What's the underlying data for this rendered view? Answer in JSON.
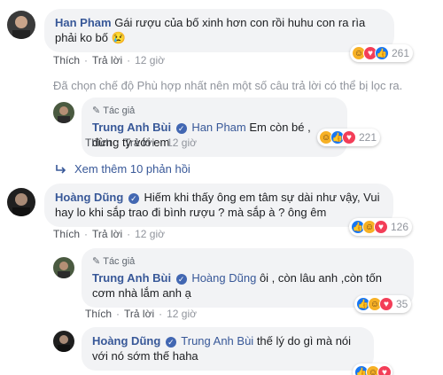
{
  "author_badge": "Tác giả",
  "actions": {
    "like": "Thích",
    "reply": "Trả lời",
    "separator": "·"
  },
  "verified_mark": "✓",
  "comments": [
    {
      "name": "Han Pham",
      "text": "Gái rượu của bố xinh hơn con rồi huhu con ra rìa phải ko bố 😢",
      "time": "12 giờ",
      "reaction_count": "261"
    },
    {
      "name": "Hoàng Dũng",
      "text": "Hiếm khi thấy ông em tâm sự dài như vậy, Vui hay lo khi sắp trao đi bình rượu ? mà sắp à ? ông êm",
      "time": "12 giờ",
      "reaction_count": "126"
    }
  ],
  "replies": [
    {
      "name": "Trung Anh Bùi",
      "tag": "Han Pham",
      "text": "Em còn bé , đừng ty với em",
      "time": "12 giờ",
      "reaction_count": "221"
    },
    {
      "name": "Trung Anh Bùi",
      "tag": "Hoàng Dũng",
      "text": "ôi , còn lâu anh ,còn tốn cơm nhà lắm anh ạ",
      "time": "12 giờ",
      "reaction_count": "35"
    },
    {
      "name": "Hoàng Dũng",
      "tag": "Trung Anh Bùi",
      "text": "thế lý do gì mà nói với nó sớm thế haha"
    }
  ],
  "filter_note": "Đã chọn chế độ Phù hợp nhất nên một số câu trả lời có thể bị lọc ra.",
  "view_more": "Xem thêm 10 phản hồi",
  "colors": {
    "link_blue": "#385898",
    "bubble_gray": "#f2f3f5",
    "like_blue": "#1877f2",
    "love_red": "#f33e58",
    "haha_yellow": "#f7b125"
  },
  "icons": {
    "like": "like-icon",
    "love": "love-icon",
    "haha": "haha-icon",
    "verified": "verified-icon",
    "more_arrow": "reply-arrow-icon"
  }
}
